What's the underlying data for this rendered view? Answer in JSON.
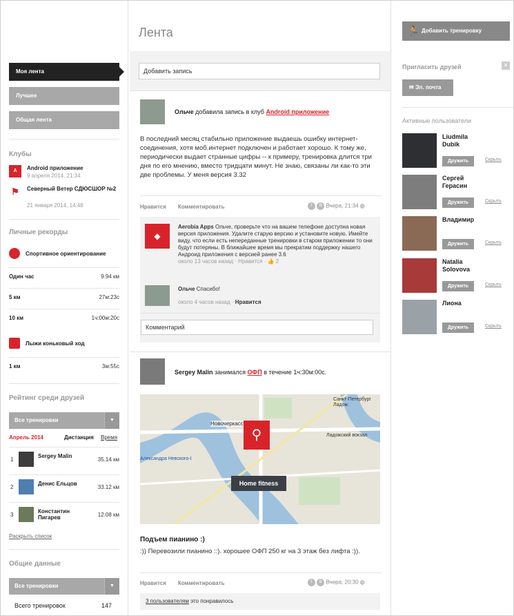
{
  "header": {
    "title": "Лента",
    "add_workout": "Добавить тренировку"
  },
  "nav": {
    "items": [
      "Моя лента",
      "Лучшее",
      "Общая лента"
    ]
  },
  "clubs": {
    "title": "Клубы",
    "items": [
      {
        "name": "Android приложение",
        "date": "9 апреля 2014, 21:34",
        "icon": "A"
      },
      {
        "name": "Северный Ветер СДЮСШОР №2",
        "date": "21 января 2014, 14:48",
        "icon": "flag"
      }
    ]
  },
  "records": {
    "title": "Личные рекорды",
    "sports": [
      {
        "name": "Спортивное ориентирование",
        "rows": [
          {
            "label": "Один час",
            "value": "9.94 км"
          },
          {
            "label": "5 км",
            "value": "27м:23с"
          },
          {
            "label": "10 км",
            "value": "1ч:00м:20с"
          }
        ]
      },
      {
        "name": "Лыжи коньковый ход",
        "rows": [
          {
            "label": "1 км",
            "value": "3м:55с"
          }
        ]
      }
    ]
  },
  "rating": {
    "title": "Рейтинг среди друзей",
    "select": "Все тренировки",
    "month": "Апрель 2014",
    "col_distance": "Дистанция",
    "col_time": "Время",
    "expand": "Раскрыть список",
    "rows": [
      {
        "n": "1",
        "name": "Sergey Malin",
        "km": "35.14 км"
      },
      {
        "n": "2",
        "name": "Денис Ельцов",
        "km": "33.12 км"
      },
      {
        "n": "3",
        "name": "Константин Пигарев",
        "km": "12.08 км"
      }
    ]
  },
  "totals": {
    "title": "Общие данные",
    "select": "Все тренировки",
    "label": "Всего тренировок",
    "value": "147"
  },
  "composer": {
    "placeholder": "Добавить запись"
  },
  "post1": {
    "author": "Ольче",
    "verb": "добавила запись в клуб",
    "club": "Android приложение",
    "text": "В последний месяц стабильно приложение выдаешь ошибку интернет-соединения, хотя моб.интернет подключен и работает хорошо. К тому же, периодически выдает странные цифры -- к примеру, тренировка длится три дня по его мнению, вместо тридцати минут. Не знаю, связаны ли как-то эти две проблемы. У меня версия 3.32",
    "like": "Нравится",
    "comment": "Комментировать",
    "time": "Вчера, 21:34",
    "c1_author": "Aerobia Apps",
    "c1_text": "Ольче, проверьте что на вашем телефоне доступна новая версия приложения. Удалите старую версию и установите новую. Имейте виду, что если есть непереданные тренировки в старом приложении то они будут потеряны. В ближайшее время мы прекратим поддержку нашего Андроид приложения с версией ранее 3.6",
    "c1_meta": "около 13 часов назад · Нравится ·",
    "c1_likes": "2",
    "c2_author": "Ольче",
    "c2_text": "Спасибо!",
    "c2_meta": "около 4 часов назад ·",
    "c2_like": "Нравится",
    "comment_placeholder": "Комментарий"
  },
  "post2": {
    "author": "Sergey Malin",
    "verb": "занимался",
    "sport": "ОФП",
    "rest": "в течение 1ч:30м:00с.",
    "map_label": "Home fitness",
    "map_places": [
      "Новочеркасская",
      "Александра Невского-I",
      "Санкт-Петербург Ладож.",
      "Ладожский вокзал"
    ],
    "heading": "Подъем пианино :)",
    "text": ":)) Перевозили пианино ::). хорошее ОФП 250 кг на 3 этаж без лифта :)).",
    "like": "Нравится",
    "comment": "Комментировать",
    "time": "Вчера, 20:30",
    "liked_by": "3 пользователям",
    "liked_rest": "это понравилось"
  },
  "invite": {
    "title": "Пригласить друзей",
    "email": "Эл. почта"
  },
  "active": {
    "title": "Активные пользователи",
    "add": "Дружить",
    "hide": "Скрыть",
    "users": [
      "Liudmila Dubik",
      "Сергей Герасин",
      "Владимир",
      "Natalia Solovova",
      "Лиона"
    ]
  }
}
